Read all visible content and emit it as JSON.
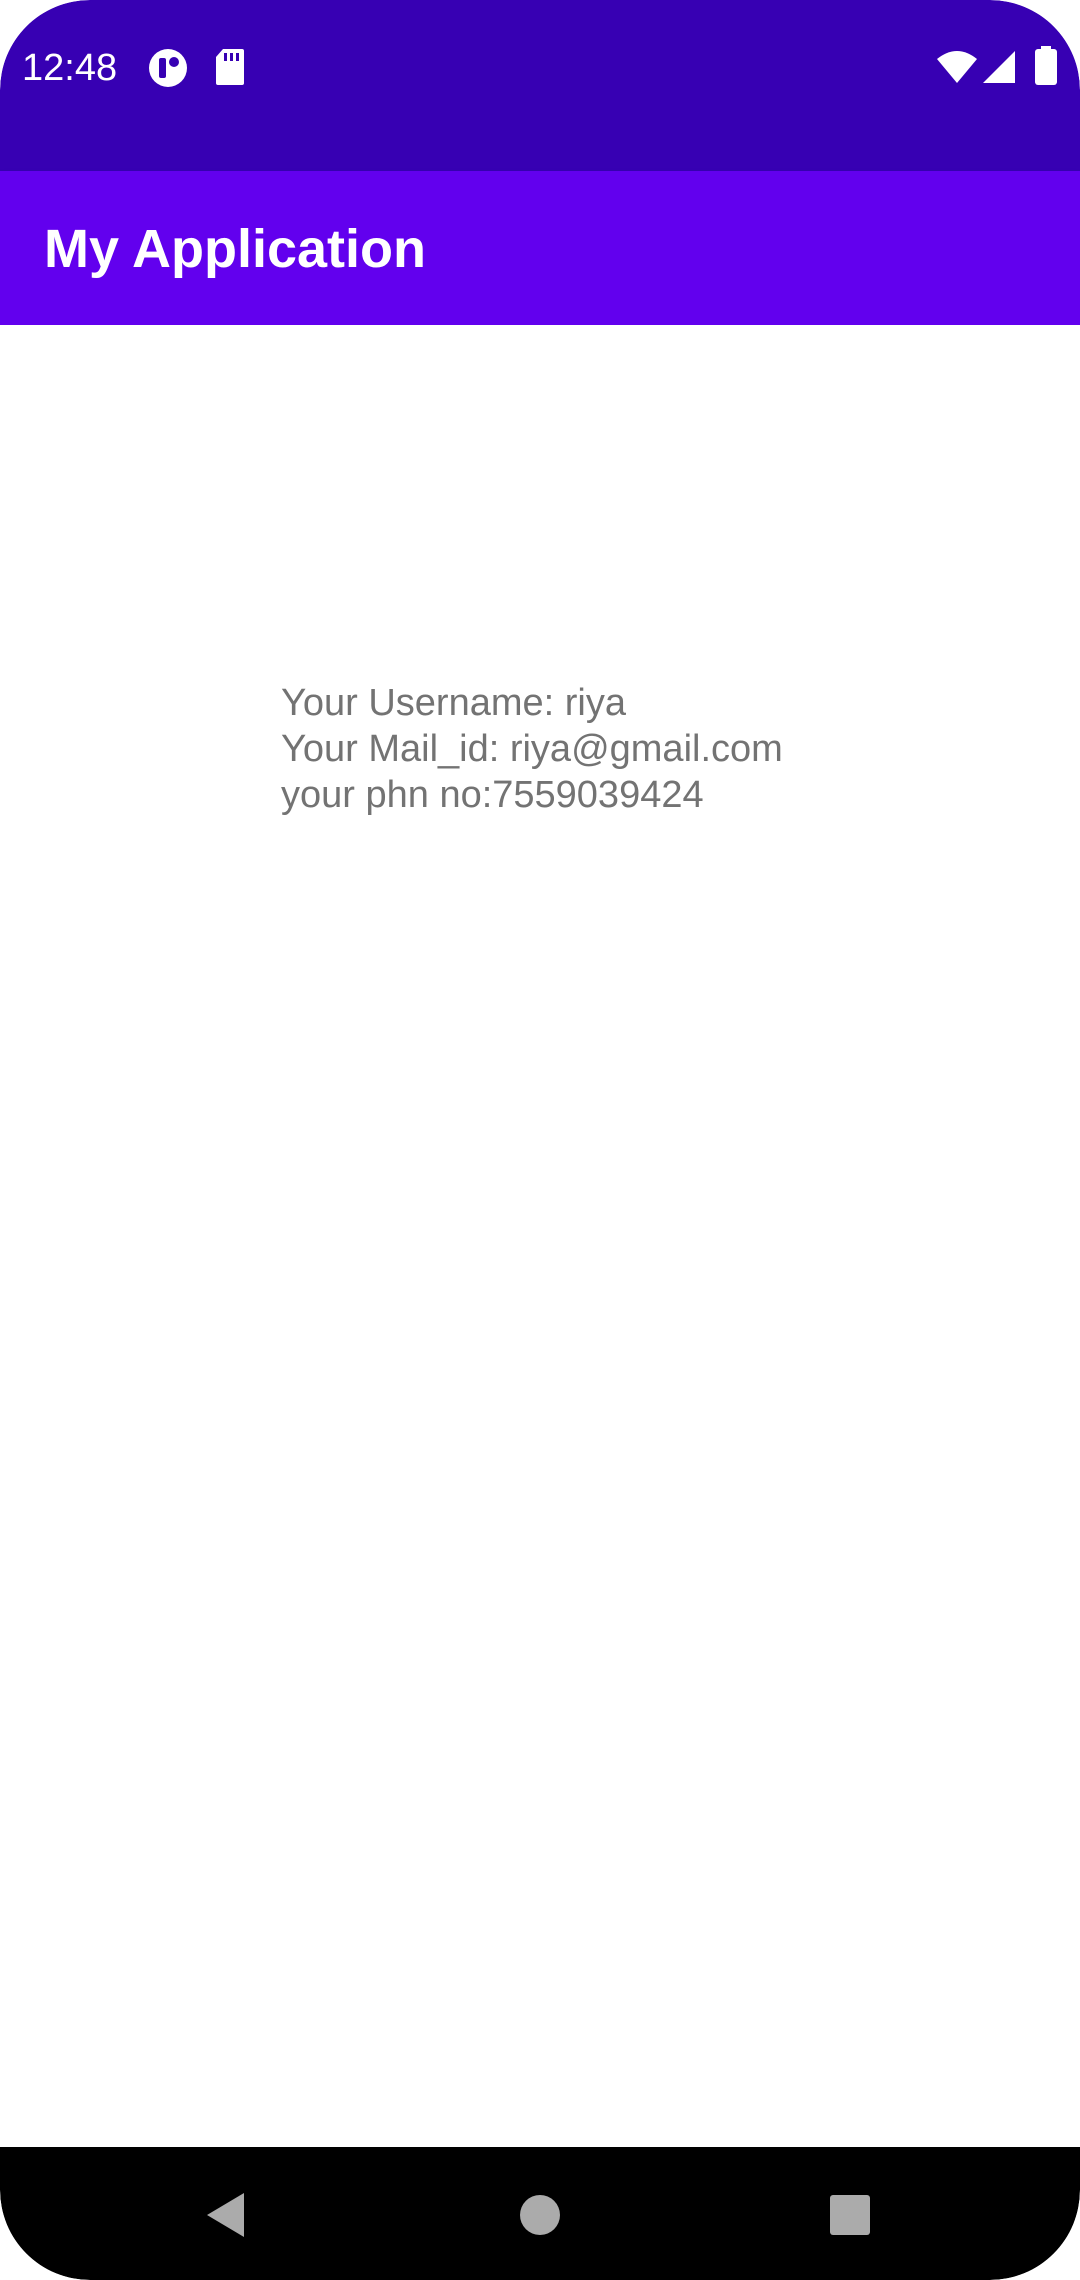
{
  "status_bar": {
    "time": "12:48",
    "left_icons": [
      "notification-app-icon",
      "sd-card-icon"
    ],
    "right_icons": [
      "wifi-icon",
      "cell-signal-icon",
      "battery-icon"
    ],
    "background": "#3700b3"
  },
  "app_bar": {
    "title": "My Application",
    "background": "#6200ee"
  },
  "content": {
    "username_line": "Your Username: riya",
    "mail_line": "Your Mail_id: riya@gmail.com",
    "phone_line": "your phn no:7559039424",
    "text_color": "#737373"
  },
  "nav_bar": {
    "buttons": [
      "back-icon",
      "home-icon",
      "recents-icon"
    ]
  }
}
